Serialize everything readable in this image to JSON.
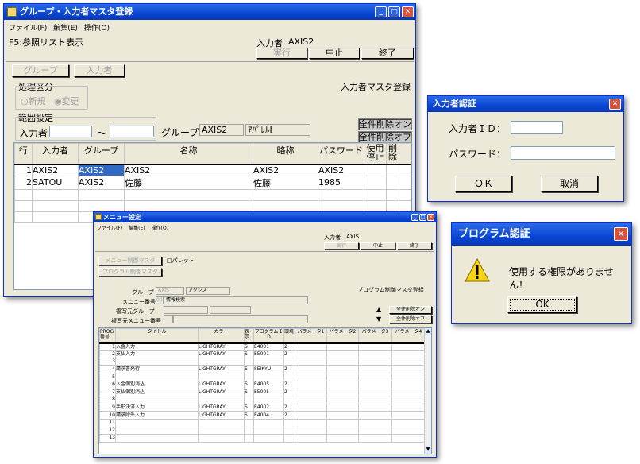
{
  "main_window": {
    "title": "グループ・入力者マスタ登録",
    "menu": [
      "ファイル(F)",
      "編集(E)",
      "操作(O)"
    ],
    "hint": "F5:参照リスト表示",
    "user_label": "入力者",
    "user_value": "AXIS2",
    "btn_run": "実行",
    "btn_stop": "中止",
    "btn_end": "終了",
    "tab_group": "グループ",
    "tab_inputter": "入力者",
    "screen_name": "入力者マスタ登録",
    "proc_title": "処理区分",
    "proc_new": "新規",
    "proc_change": "変更",
    "range_title": "範囲設定",
    "range_label": "入力者",
    "range_sep": "～",
    "group_label": "グループ",
    "group_code": "AXIS2",
    "group_name": "ｱﾊﾟﾚﾙⅠ",
    "btn_delete_on": "全件削除オン",
    "btn_delete_off": "全件削除オフ",
    "headers": [
      "行",
      "入力者",
      "グループ",
      "名称",
      "略称",
      "パスワード",
      "使用停止",
      "削除"
    ],
    "rows": [
      [
        "1",
        "AXIS2",
        "AXIS2",
        "AXIS2",
        "AXIS2",
        "AXIS2",
        "",
        ""
      ],
      [
        "2",
        "SATOU",
        "AXIS2",
        "佐藤",
        "佐藤",
        "1985",
        "",
        ""
      ]
    ]
  },
  "login_dialog": {
    "title": "入力者認証",
    "id_label": "入力者ＩＤ：",
    "pw_label": "パスワード：",
    "ok": "ＯＫ",
    "cancel": "取消"
  },
  "alert_dialog": {
    "title": "プログラム認証",
    "message": "使用する権限がありません！",
    "ok": "OK"
  },
  "menu_window": {
    "title": "メニュー設定",
    "menu": [
      "ファイル(F)",
      "編集(E)",
      "操作(O)"
    ],
    "user_label": "入力者",
    "user_value": "AXIS",
    "btn_run": "実行",
    "btn_stop": "中止",
    "btn_end": "終了",
    "tab_menu": "メニュー制御マスタ",
    "tab_program": "プログラム制御マスタ",
    "palette": "パレット",
    "screen_name": "プログラム制御マスタ登録",
    "group_label": "グループ",
    "group_code": "AXIS",
    "group_name": "アクシス",
    "menu_no_label": "メニュー番号",
    "menu_no": "00",
    "menu_name": "情報検索",
    "copy_group_label": "複写元グループ",
    "copy_menu_label": "複写元メニュー番号",
    "btn_delete_on": "全件削除オン",
    "btn_delete_off": "全件削除オフ",
    "headers": [
      "PROG\n番号",
      "タイトル",
      "カラー",
      "表示",
      "プログラムＩＤ",
      "環境",
      "パラメータ1",
      "パラメータ2",
      "パラメータ3",
      "パラメータ4"
    ],
    "rows": [
      [
        "1",
        "入金入力",
        "LIGHTGRAY",
        "S",
        "E4001",
        "2"
      ],
      [
        "2",
        "支払入力",
        "LIGHTGRAY",
        "S",
        "E5001",
        "2"
      ],
      [
        "3",
        "",
        "",
        "",
        "",
        ""
      ],
      [
        "4",
        "請求書発行",
        "LIGHTGRAY",
        "S",
        "SEIKYU",
        "2"
      ],
      [
        "5",
        "",
        "",
        "",
        "",
        ""
      ],
      [
        "6",
        "入金個別消込",
        "LIGHTGRAY",
        "S",
        "E4005",
        "2"
      ],
      [
        "7",
        "支払個別消込",
        "LIGHTGRAY",
        "S",
        "E5005",
        "2"
      ],
      [
        "8",
        "",
        "",
        "",
        "",
        ""
      ],
      [
        "9",
        "手形決済入力",
        "LIGHTGRAY",
        "S",
        "E4002",
        "2"
      ],
      [
        "10",
        "請求除外入力",
        "LIGHTGRAY",
        "S",
        "E4004",
        "2"
      ],
      [
        "11",
        "",
        "",
        "",
        "",
        ""
      ],
      [
        "12",
        "",
        "",
        "",
        "",
        ""
      ],
      [
        "13",
        "",
        "",
        "",
        "",
        ""
      ]
    ]
  },
  "colors": {
    "title_bar": "#0a46d3",
    "window_bg": "#ece9d8",
    "close_button": "#d8533a"
  }
}
